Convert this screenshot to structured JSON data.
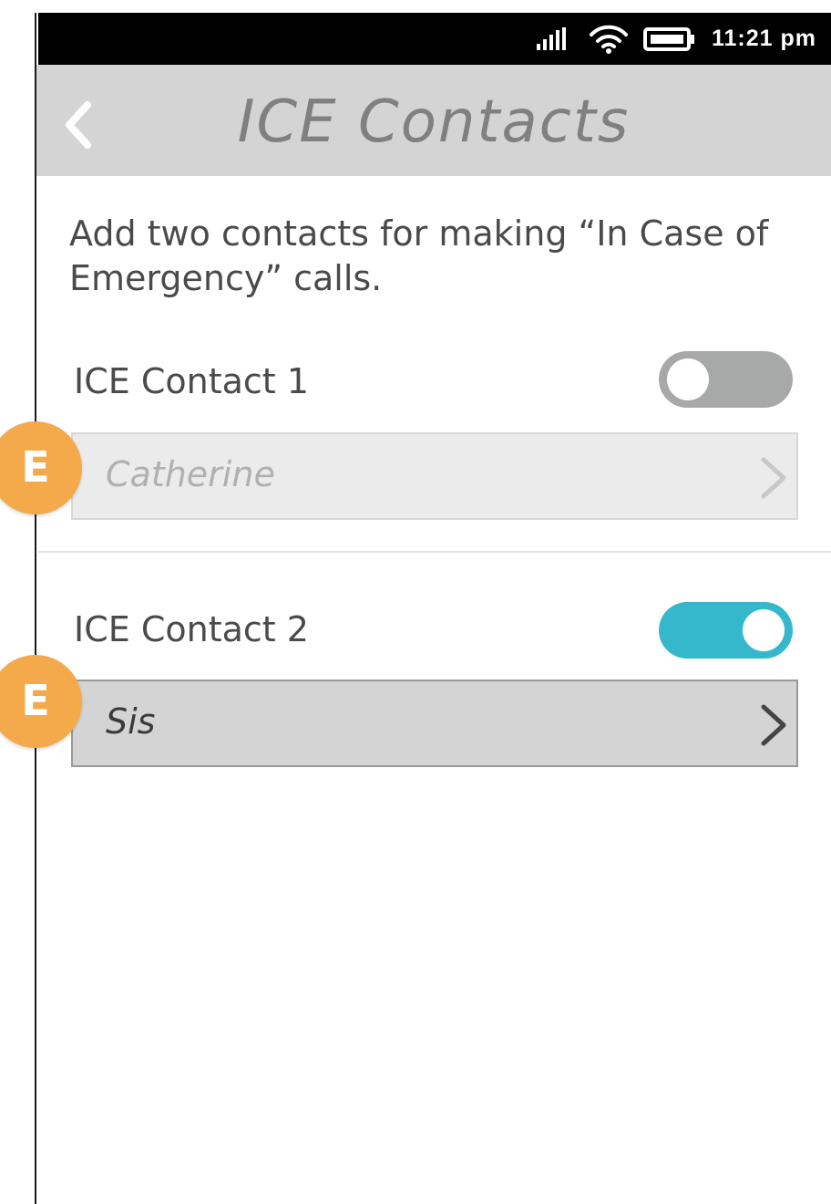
{
  "status_bar": {
    "time": "11:21 pm",
    "icons": [
      "signal-icon",
      "wifi-icon",
      "battery-icon"
    ]
  },
  "header": {
    "title": "ICE Contacts",
    "back_icon": "chevron-left-icon"
  },
  "intro_text": "Add two contacts for making “In Case of Emergency” calls.",
  "contacts": [
    {
      "label": "ICE Contact 1",
      "enabled": false,
      "value": "Catherine",
      "badge": "E"
    },
    {
      "label": "ICE Contact 2",
      "enabled": true,
      "value": "Sis",
      "badge": "E"
    }
  ],
  "colors": {
    "toggle_on": "#35b8cc",
    "toggle_off": "#a7a9a8",
    "badge": "#f4a94b",
    "header_bg": "#d4d4d4"
  }
}
